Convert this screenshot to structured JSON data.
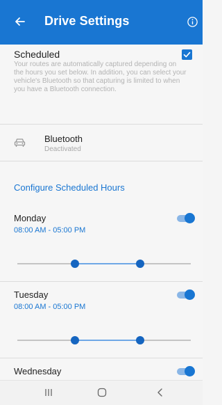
{
  "app_bar": {
    "title": "Drive Settings",
    "back_icon": "arrow-left-icon",
    "info_icon": "info-icon"
  },
  "scheduled": {
    "label": "Scheduled",
    "description": "Your routes are automatically captured depending on the hours you set below. In addition, you can select your vehicle's Bluetooth so that capturing is limited to when you have a Bluetooth connection.",
    "checked": true
  },
  "bluetooth": {
    "icon": "car-icon",
    "name": "Bluetooth",
    "status": "Deactivated"
  },
  "configure_heading": "Configure Scheduled Hours",
  "days": [
    {
      "name": "Monday",
      "hours": "08:00 AM - 05:00 PM",
      "enabled": true,
      "range_start": 0.333,
      "range_end": 0.708
    },
    {
      "name": "Tuesday",
      "hours": "08:00 AM - 05:00 PM",
      "enabled": true,
      "range_start": 0.333,
      "range_end": 0.708
    },
    {
      "name": "Wednesday",
      "enabled": true
    }
  ],
  "colors": {
    "primary": "#1976d2",
    "toggle_track": "#8ab6e6",
    "slider_range": "#6fa8e6"
  },
  "nav_bar": {
    "recents_icon": "recents-icon",
    "home_icon": "home-icon",
    "back_icon": "back-chevron-icon"
  }
}
